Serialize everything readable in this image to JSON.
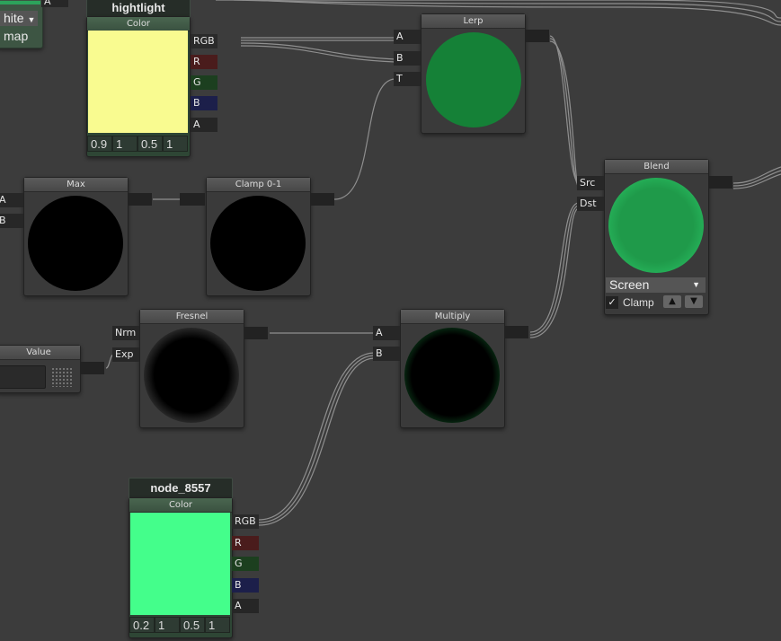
{
  "nodes": {
    "highlight": {
      "name": "hightlight",
      "title": "Color",
      "swatch": "#f9fb90",
      "outputs": [
        "RGB",
        "R",
        "G",
        "B",
        "A"
      ],
      "values": [
        "0.9",
        "1",
        "0.5",
        "1"
      ]
    },
    "node8557": {
      "name": "node_8557",
      "title": "Color",
      "swatch": "#44fe8b",
      "outputs": [
        "RGB",
        "R",
        "G",
        "B",
        "A"
      ],
      "values": [
        "0.2",
        "1",
        "0.5",
        "1"
      ]
    },
    "lerp": {
      "title": "Lerp",
      "inputs": [
        "A",
        "B",
        "T"
      ],
      "preview_color": "#158137"
    },
    "blend": {
      "title": "Blend",
      "inputs": [
        "Src",
        "Dst"
      ],
      "preview_color": "#23a24f",
      "mode": "Screen",
      "clamp_label": "Clamp",
      "clamp_checked": "✓",
      "up_arrow": "▲",
      "down_arrow": "▼"
    },
    "max": {
      "title": "Max",
      "inputs": [
        "A",
        "B"
      ]
    },
    "clamp": {
      "title": "Clamp 0-1"
    },
    "fresnel": {
      "title": "Fresnel",
      "inputs": [
        "Nrm",
        "Exp"
      ]
    },
    "multiply": {
      "title": "Multiply",
      "inputs": [
        "A",
        "B"
      ]
    },
    "value": {
      "title": "Value"
    },
    "topleft": {
      "dropdown": "hite",
      "label": "map",
      "port": "A"
    }
  },
  "colors": {
    "canvas": "#3c3c3c",
    "wire": "#9a9a9a",
    "r_port": "#4a1c1c",
    "g_port": "#1c3f1f",
    "b_port": "#1c1f4a"
  },
  "icons": [
    "dropdown-arrow-icon",
    "checkmark-icon",
    "arrow-up-icon",
    "arrow-down-icon"
  ]
}
